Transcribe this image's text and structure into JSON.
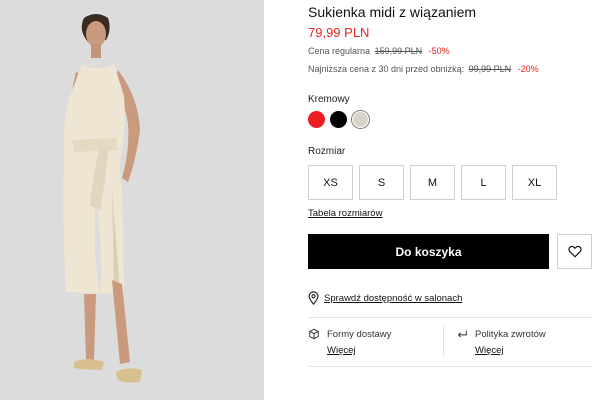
{
  "product": {
    "title": "Sukienka midi z wiązaniem",
    "price": "79,99 PLN",
    "regular_label": "Cena regularna",
    "regular_price": "159,99 PLN",
    "regular_discount": "-50%",
    "lowest_label": "Najniższa cena z 30 dni przed obniżką:",
    "lowest_price": "99,99 PLN",
    "lowest_discount": "-20%"
  },
  "colors": {
    "selected_label": "Kremowy",
    "swatches": [
      {
        "name": "red",
        "hex": "#ee1d24"
      },
      {
        "name": "black",
        "hex": "#000000"
      },
      {
        "name": "cream",
        "hex": "#d9d3c7",
        "selected": true
      }
    ]
  },
  "sizes": {
    "label": "Rozmiar",
    "options": [
      "XS",
      "S",
      "M",
      "L",
      "XL"
    ],
    "size_table_link": "Tabela rozmiarów"
  },
  "actions": {
    "add_to_cart": "Do koszyka",
    "wishlist_icon": "heart-icon"
  },
  "store": {
    "icon": "location-pin-icon",
    "link": "Sprawdź dostępność w salonach"
  },
  "features": [
    {
      "icon": "package-icon",
      "title": "Formy dostawy",
      "link": "Więcej"
    },
    {
      "icon": "return-arrow-icon",
      "title": "Polityka zwrotów",
      "link": "Więcej"
    }
  ],
  "theme": {
    "accent": "#e4261d",
    "button": "#000000"
  }
}
